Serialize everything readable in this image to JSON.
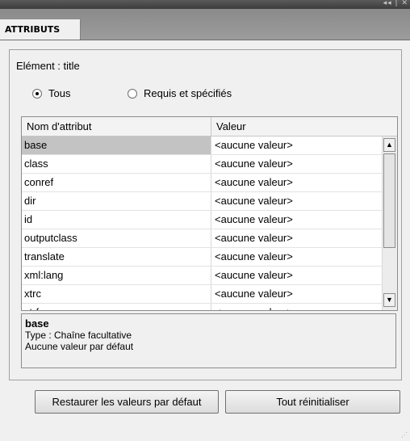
{
  "window": {
    "controls": "◂◂ | ✕"
  },
  "tab": {
    "label": "ATTRIBUTS"
  },
  "element": {
    "label": "Elément : title"
  },
  "filter": {
    "options": [
      {
        "label": "Tous",
        "checked": true
      },
      {
        "label": "Requis et spécifiés",
        "checked": false
      }
    ]
  },
  "table": {
    "headers": [
      "Nom d'attribut",
      "Valeur"
    ],
    "rows": [
      {
        "name": "base",
        "value": "<aucune valeur>"
      },
      {
        "name": "class",
        "value": "<aucune valeur>"
      },
      {
        "name": "conref",
        "value": "<aucune valeur>"
      },
      {
        "name": "dir",
        "value": "<aucune valeur>"
      },
      {
        "name": "id",
        "value": "<aucune valeur>"
      },
      {
        "name": "outputclass",
        "value": "<aucune valeur>"
      },
      {
        "name": "translate",
        "value": "<aucune valeur>"
      },
      {
        "name": "xml:lang",
        "value": "<aucune valeur>"
      },
      {
        "name": "xtrc",
        "value": "<aucune valeur>"
      },
      {
        "name": "xtrf",
        "value": "<aucune valeur>"
      }
    ],
    "selected_row": 0
  },
  "description": {
    "name": "base",
    "type": "Type : Chaîne facultative",
    "default": "Aucune valeur par défaut"
  },
  "buttons": {
    "restore": "Restaurer les valeurs par défaut",
    "reset": "Tout réinitialiser"
  },
  "scroll_icons": {
    "up": "▲",
    "down": "▼"
  }
}
